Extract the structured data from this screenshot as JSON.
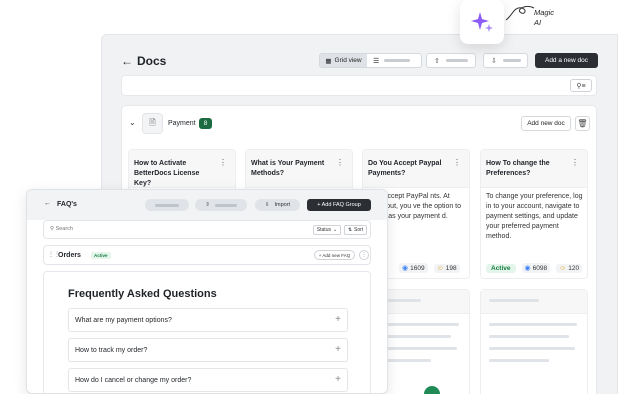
{
  "docs": {
    "back_icon": "arrow-left-icon",
    "title": "Docs",
    "grid_view_label": "Grid view",
    "add_doc_label": "Add a new doc"
  },
  "payment": {
    "label": "Payment",
    "count": "8",
    "add_new_doc_label": "Add new doc"
  },
  "doc_cards": [
    {
      "title": "How to Activate BetterDocs License Key?",
      "body": "",
      "status": "",
      "views": "",
      "reactions": ""
    },
    {
      "title": "What is Your Payment Methods?",
      "body": "",
      "status": "",
      "views": "",
      "reactions": ""
    },
    {
      "title": "Do You Accept Paypal Payments?",
      "body": "e do accept PayPal nts. At checkout, you ve the option to select as your payment d.",
      "status": "",
      "views": "1609",
      "reactions": "198"
    },
    {
      "title": "How To change the Preferences?",
      "body": "To change your preference, log in to your account, navigate to payment settings, and update your preferred payment method.",
      "status": "Active",
      "views": "6098",
      "reactions": "120"
    }
  ],
  "faq": {
    "title": "FAQ's",
    "import_label": "Import",
    "add_group_label": "+ Add FAQ Group",
    "search_placeholder": "Search",
    "status_label": "Status",
    "sort_label": "Sort",
    "group_name": "Orders",
    "group_status": "Active",
    "add_new_faq_label": "+ Add new FAQ",
    "heading": "Frequently Asked Questions",
    "questions": [
      "What are my payment options?",
      "How to track my order?",
      "How do I cancel or change my order?"
    ]
  },
  "magic_ai": {
    "label_line1": "Magic",
    "label_line2": "AI",
    "icon": "sparkle-icon"
  },
  "colors": {
    "accent_dark": "#2b2f33",
    "active_green": "#1d6b40",
    "sparkle_purple": "#8b5cf6"
  }
}
